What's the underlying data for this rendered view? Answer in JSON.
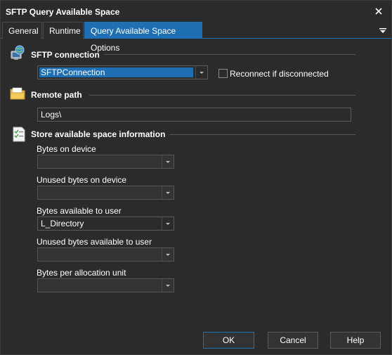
{
  "window": {
    "title": "SFTP Query Available Space",
    "close_icon": "close-icon"
  },
  "tabs": [
    {
      "label": "General",
      "active": false
    },
    {
      "label": "Runtime",
      "active": false
    },
    {
      "label": "Query Available Space Options",
      "active": true
    }
  ],
  "sftp_connection": {
    "heading": "SFTP connection",
    "icon": "globe-computer-icon",
    "value": "SFTPConnection",
    "reconnect_label": "Reconnect if disconnected",
    "reconnect_checked": false
  },
  "remote_path": {
    "heading": "Remote path",
    "icon": "folder-icon",
    "value": "Logs\\"
  },
  "store": {
    "heading": "Store available space information",
    "icon": "checklist-icon",
    "fields": [
      {
        "label": "Bytes on device",
        "value": ""
      },
      {
        "label": "Unused bytes on device",
        "value": ""
      },
      {
        "label": "Bytes available to user",
        "value": "L_Directory"
      },
      {
        "label": "Unused bytes available to user",
        "value": ""
      },
      {
        "label": "Bytes per allocation unit",
        "value": ""
      }
    ]
  },
  "buttons": {
    "ok": "OK",
    "cancel": "Cancel",
    "help": "Help"
  },
  "colors": {
    "background": "#2b2b2b",
    "accent": "#1f6fb5",
    "text": "#ffffff"
  }
}
